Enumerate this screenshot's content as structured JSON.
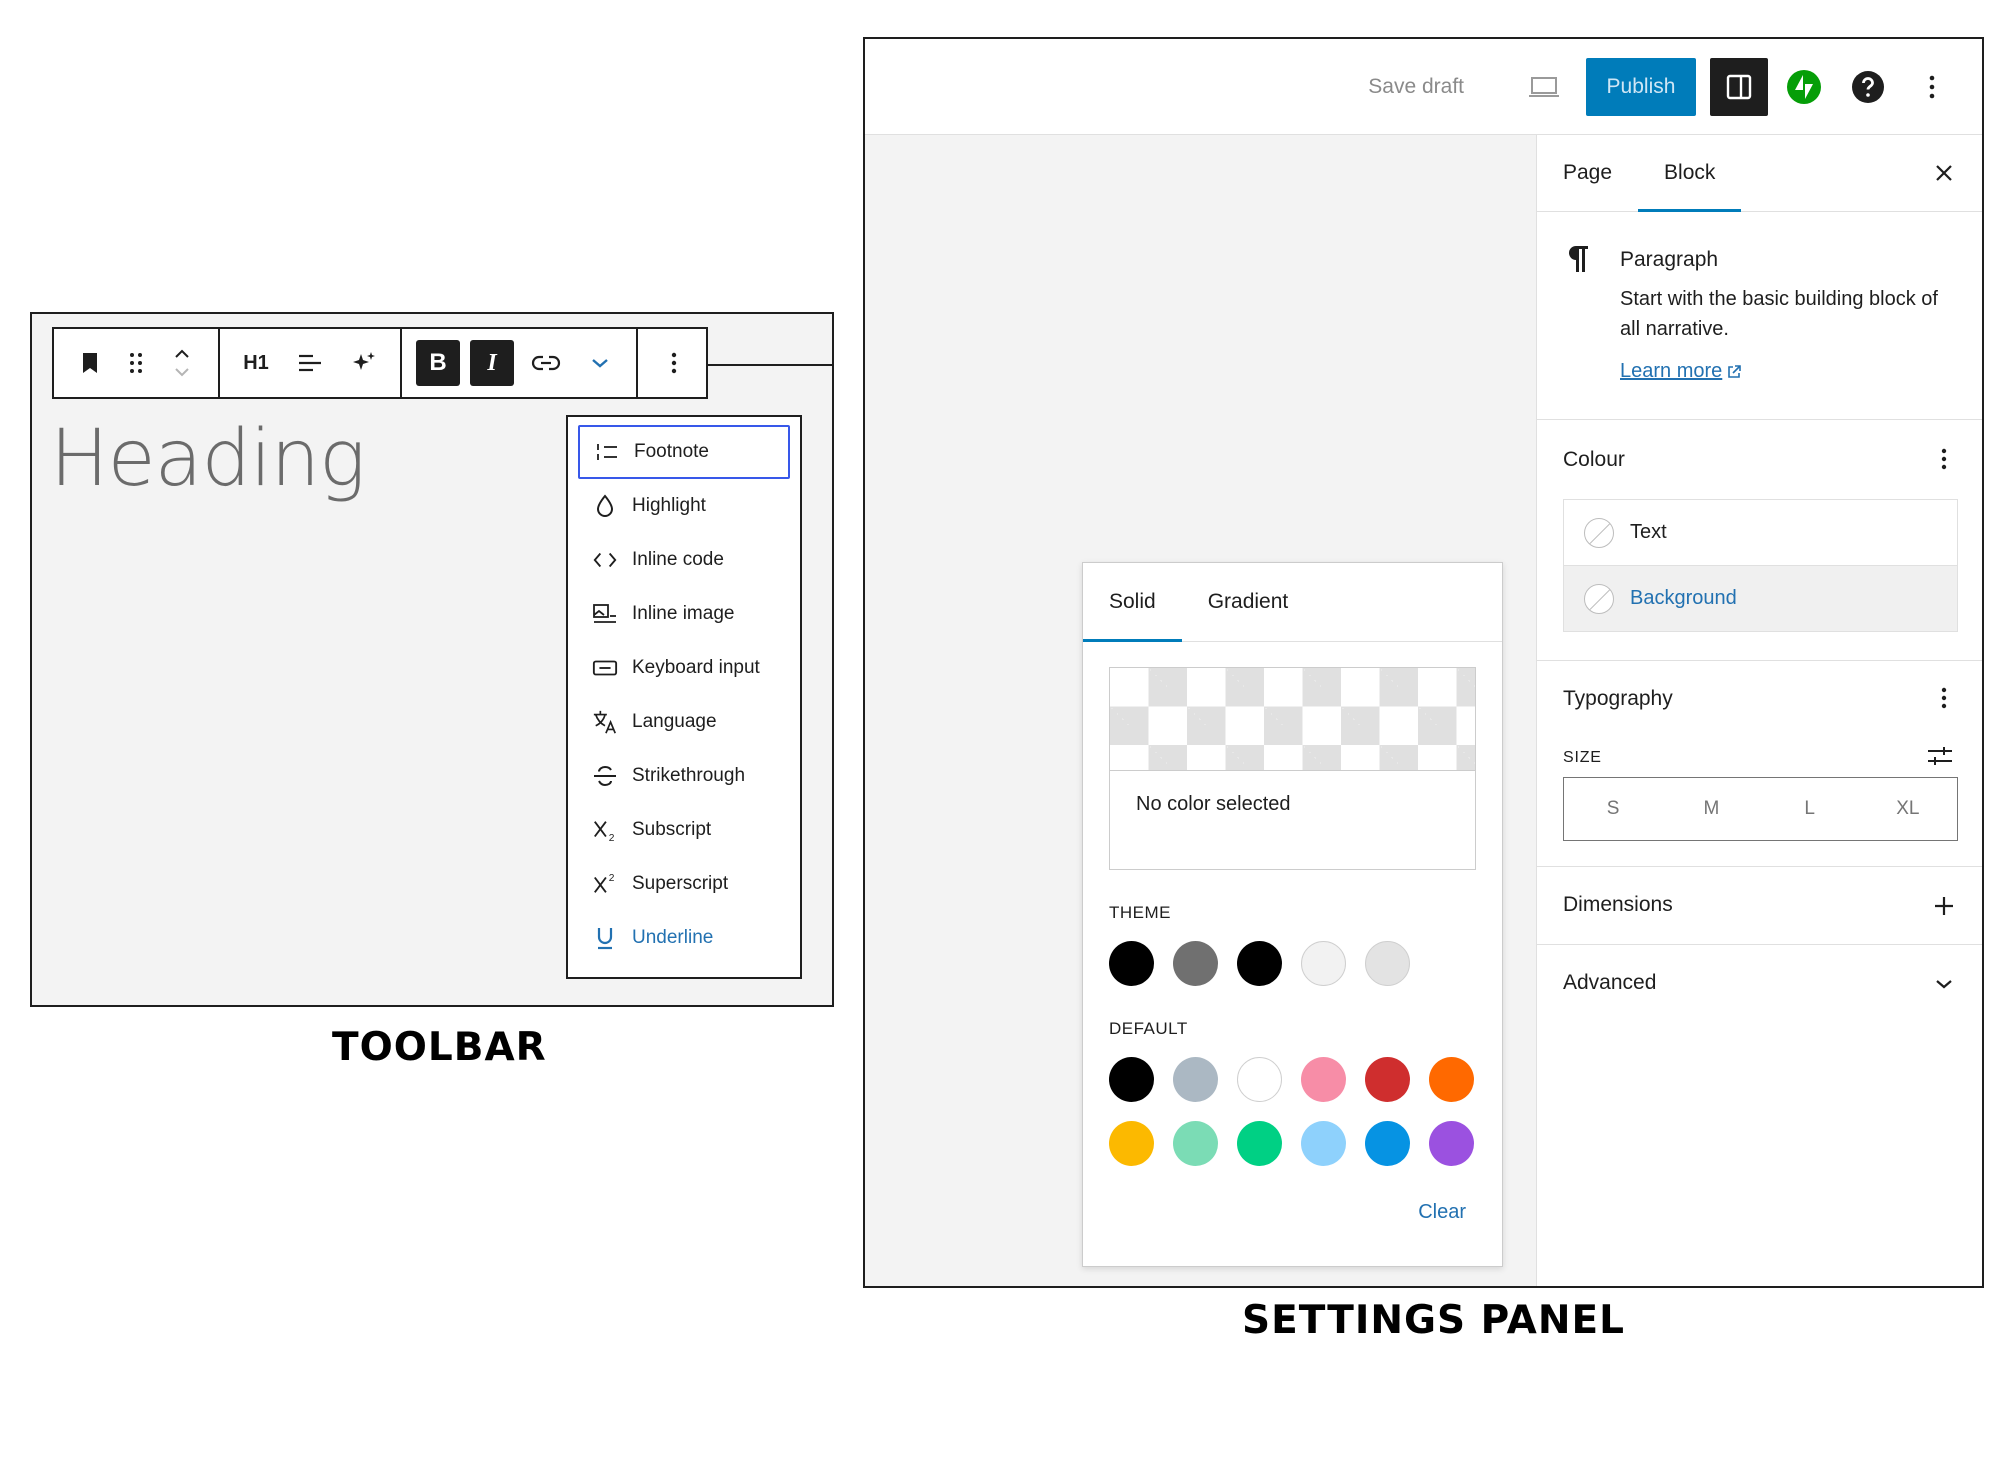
{
  "captions": {
    "toolbar": "TOOLBAR",
    "settings": "SETTINGS PANEL"
  },
  "toolbar": {
    "heading_level_label": "H1",
    "bold_label": "B",
    "italic_label": "I",
    "heading_text": "Heading",
    "format_menu": [
      {
        "label": "Footnote",
        "icon": "footnote-icon"
      },
      {
        "label": "Highlight",
        "icon": "highlight-icon"
      },
      {
        "label": "Inline code",
        "icon": "code-icon"
      },
      {
        "label": "Inline image",
        "icon": "inline-image-icon"
      },
      {
        "label": "Keyboard input",
        "icon": "keyboard-icon"
      },
      {
        "label": "Language",
        "icon": "language-icon"
      },
      {
        "label": "Strikethrough",
        "icon": "strikethrough-icon"
      },
      {
        "label": "Subscript",
        "icon": "subscript-icon"
      },
      {
        "label": "Superscript",
        "icon": "superscript-icon"
      },
      {
        "label": "Underline",
        "icon": "underline-icon"
      }
    ]
  },
  "header": {
    "save_draft": "Save draft",
    "publish": "Publish"
  },
  "sidebar": {
    "tabs": [
      "Page",
      "Block"
    ],
    "block_card": {
      "title": "Paragraph",
      "description": "Start with the basic building block of all narrative.",
      "learn_more": "Learn more"
    },
    "colour": {
      "title": "Colour",
      "items": [
        "Text",
        "Background"
      ]
    },
    "typography": {
      "title": "Typography",
      "size_label": "SIZE",
      "sizes": [
        "S",
        "M",
        "L",
        "XL"
      ]
    },
    "dimensions": {
      "title": "Dimensions"
    },
    "advanced": {
      "title": "Advanced"
    }
  },
  "color_picker": {
    "tabs": [
      "Solid",
      "Gradient"
    ],
    "no_color": "No color selected",
    "theme_label": "THEME",
    "default_label": "DEFAULT",
    "clear": "Clear",
    "theme_colors": [
      "#000000",
      "#707070",
      "#000000",
      "#f2f2f2",
      "#e3e3e3"
    ],
    "default_colors": [
      "#000000",
      "#abb8c3",
      "#ffffff",
      "#f78da7",
      "#cf2e2e",
      "#ff6900",
      "#fcb900",
      "#7bdcb5",
      "#00d084",
      "#8ed1fc",
      "#0693e3",
      "#9b51e0"
    ],
    "colors_accent": {
      "tab_underline": "#007cba",
      "link": "#2271b1",
      "publish": "#007cba"
    }
  }
}
